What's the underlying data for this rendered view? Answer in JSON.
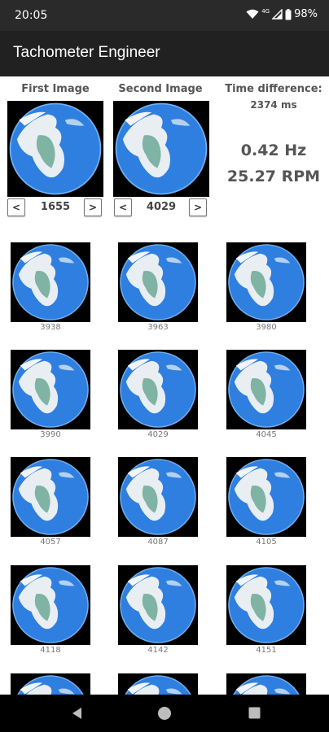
{
  "status": {
    "time": "20:05",
    "network": "4G",
    "battery": "98%"
  },
  "app": {
    "title": "Tachometer Engineer"
  },
  "first_image": {
    "header": "First Image",
    "frame": "1655",
    "prev_label": "<",
    "next_label": ">"
  },
  "second_image": {
    "header": "Second Image",
    "frame": "4029",
    "prev_label": "<",
    "next_label": ">"
  },
  "results": {
    "time_difference_label": "Time difference:",
    "time_difference_value": "2374 ms",
    "frequency": "0.42 Hz",
    "rpm": "25.27 RPM"
  },
  "frames": [
    "3938",
    "3963",
    "3980",
    "3990",
    "4029",
    "4045",
    "4057",
    "4087",
    "4105",
    "4118",
    "4142",
    "4151",
    "",
    "",
    ""
  ],
  "icons": {
    "back": "back-icon",
    "home": "home-icon",
    "recents": "recents-icon"
  },
  "colors": {
    "app_bar": "#212121",
    "status_bar": "#2a2a2a",
    "earth_blue": "#2f7fe0"
  }
}
